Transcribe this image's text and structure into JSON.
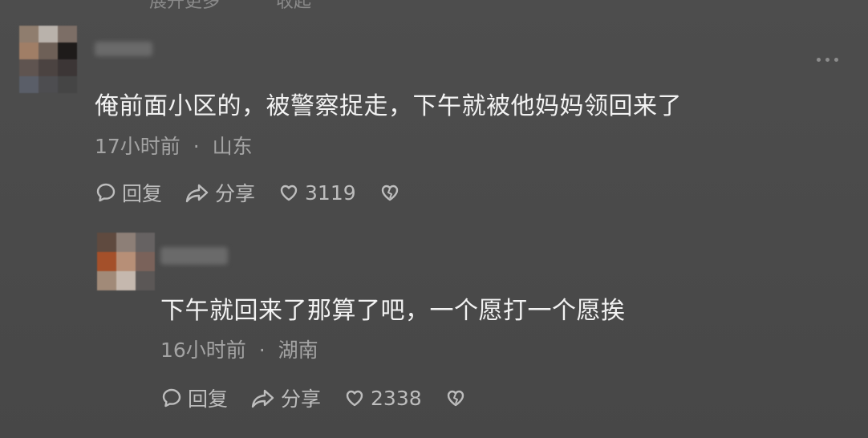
{
  "top_partial": [
    "展开更多",
    "收起"
  ],
  "comments": [
    {
      "text": "俺前面小区的，被警察捉走，下午就被他妈妈领回来了",
      "time": "17小时前",
      "separator": "·",
      "location": "山东",
      "reply_label": "回复",
      "share_label": "分享",
      "likes": "3119"
    },
    {
      "text": "下午就回来了那算了吧，一个愿打一个愿挨",
      "time": "16小时前",
      "separator": "·",
      "location": "湖南",
      "reply_label": "回复",
      "share_label": "分享",
      "likes": "2338"
    }
  ],
  "icons": {
    "reply": "comment-bubble-icon",
    "share": "share-arrow-icon",
    "like": "heart-icon",
    "dislike": "broken-heart-icon",
    "more": "more-dots-icon"
  },
  "colors": {
    "background": "#4a4a4a",
    "text_primary": "#f2f2f2",
    "text_meta": "#a4a4a4",
    "action": "#bdbdbd"
  }
}
